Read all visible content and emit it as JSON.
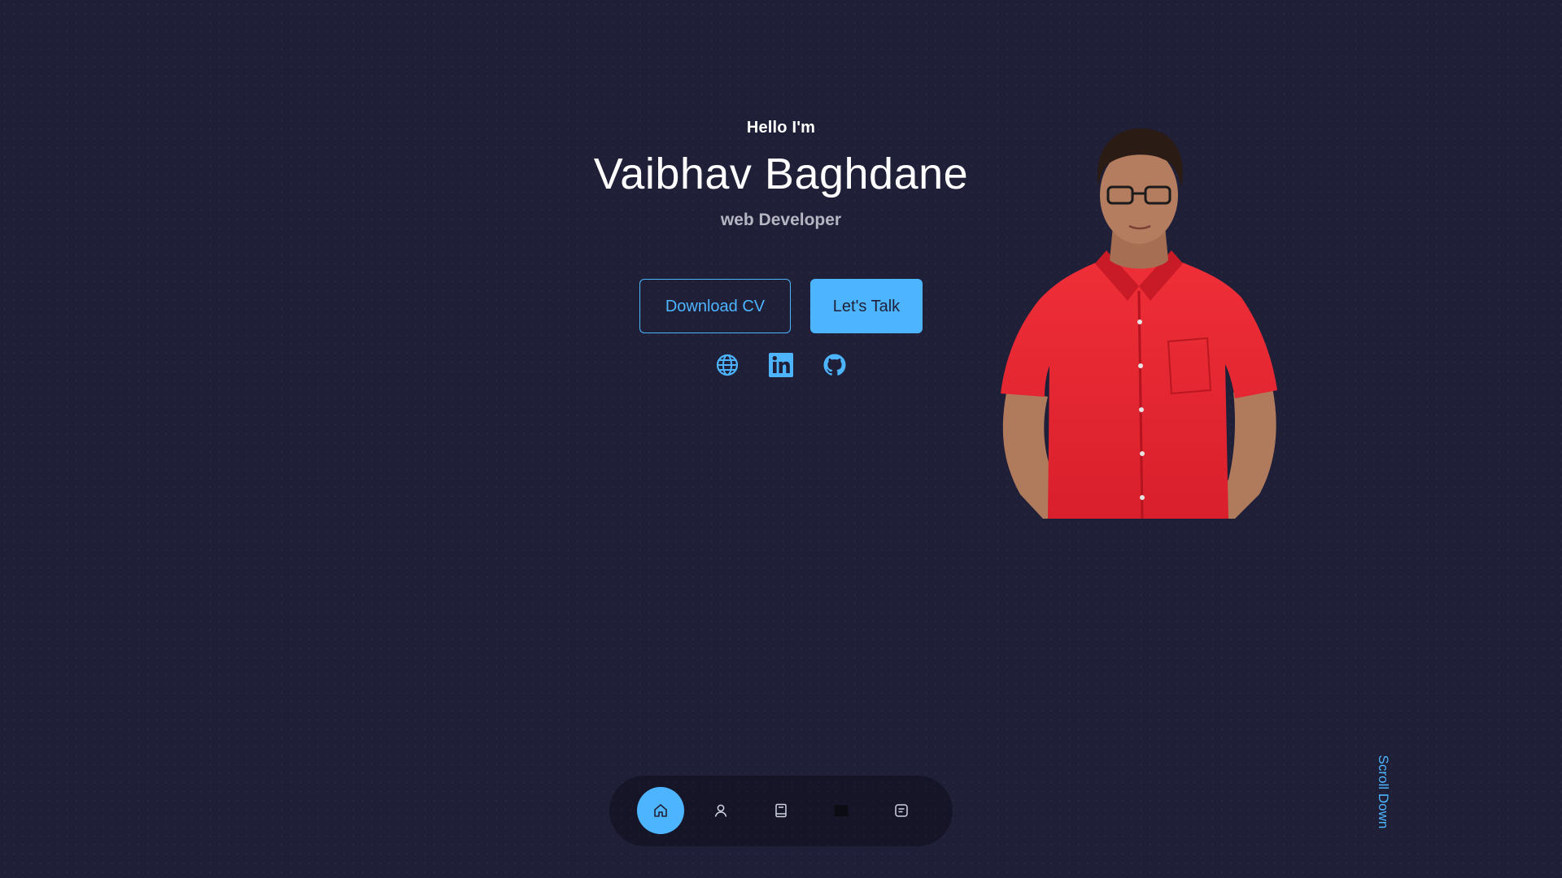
{
  "hero": {
    "greeting": "Hello I'm",
    "name": "Vaibhav Baghdane",
    "role": "web Developer"
  },
  "buttons": {
    "download_cv": "Download CV",
    "lets_talk": "Let's Talk"
  },
  "socials": [
    {
      "icon": "globe-icon"
    },
    {
      "icon": "linkedin-icon"
    },
    {
      "icon": "github-icon"
    }
  ],
  "scroll_down": "Scroll Down",
  "nav": {
    "items": [
      {
        "icon": "home-icon",
        "active": true
      },
      {
        "icon": "user-icon",
        "active": false
      },
      {
        "icon": "book-icon",
        "active": false
      },
      {
        "icon": "laptop-icon",
        "active": false
      },
      {
        "icon": "message-icon",
        "active": false
      }
    ]
  },
  "colors": {
    "background": "#1f1f38",
    "accent": "#4db5ff",
    "muted_text": "#b6b6c2"
  }
}
